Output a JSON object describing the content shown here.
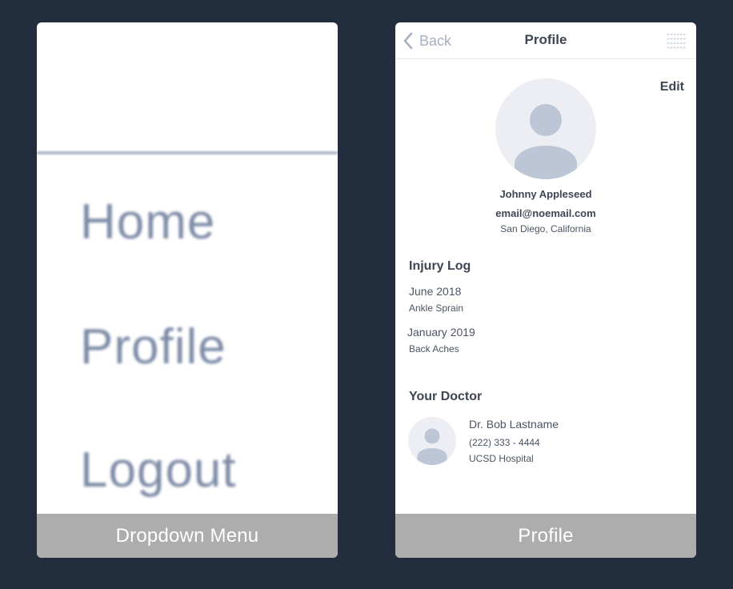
{
  "colors": {
    "background": "#222d3d",
    "card": "#ffffff",
    "caption_bar": "#adadad",
    "avatar_bg": "#eceef3",
    "avatar_fg": "#bcc6d6",
    "muted_text": "#a7b0c0",
    "dark_text": "#3f4653"
  },
  "dropdown_card": {
    "menu_items": [
      {
        "label": "Home"
      },
      {
        "label": "Profile"
      },
      {
        "label": "Logout"
      }
    ],
    "caption": "Dropdown Menu"
  },
  "profile_card": {
    "nav": {
      "back_icon": "chevron-left-icon",
      "back_label": "Back",
      "title": "Profile",
      "menu_icon": "menu-icon"
    },
    "edit_label": "Edit",
    "user": {
      "avatar_icon": "user-avatar-icon",
      "name": "Johnny Appleseed",
      "email": "email@noemail.com",
      "location": "San Diego, California"
    },
    "injury_log": {
      "heading": "Injury Log",
      "entries": [
        {
          "date": "June 2018",
          "description": "Ankle Sprain"
        },
        {
          "date": "January 2019",
          "description": "Back Aches"
        }
      ]
    },
    "doctor": {
      "heading": "Your Doctor",
      "avatar_icon": "doctor-avatar-icon",
      "name": "Dr. Bob Lastname",
      "phone": "(222) 333 - 4444",
      "hospital": "UCSD Hospital"
    },
    "caption": "Profile"
  }
}
